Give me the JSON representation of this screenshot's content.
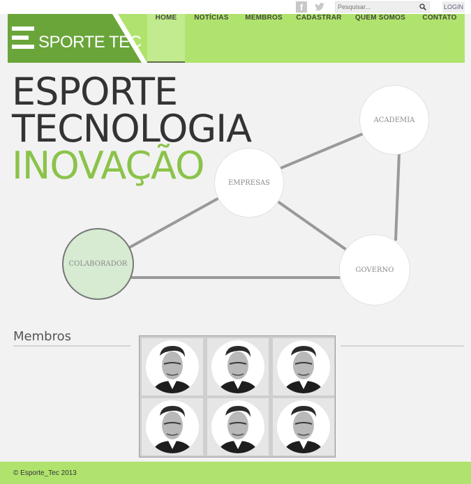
{
  "header": {
    "social": [
      {
        "icon": "facebook-icon",
        "glyph": "f"
      },
      {
        "icon": "twitter-icon"
      }
    ],
    "search": {
      "placeholder": "Pesquisar..."
    },
    "login_label": "LOGIN"
  },
  "brand": {
    "name": "SPORTE TEC",
    "accent": "#8bc34a",
    "nav_bg": "#b0e36e"
  },
  "nav": {
    "items": [
      {
        "label": "HOME",
        "active": true
      },
      {
        "label": "NOTÍCIAS"
      },
      {
        "label": "MEMBROS"
      },
      {
        "label": "CADASTRAR"
      },
      {
        "label": "QUEM SOMOS"
      },
      {
        "label": "CONTATO"
      }
    ]
  },
  "hero": {
    "line1": "ESPORTE",
    "line2": "TECNOLOGIA",
    "line3": "INOVAÇÃO"
  },
  "diagram": {
    "nodes": {
      "academia": "ACADEMIA",
      "empresas": "EMPRESAS",
      "colaborador": "COLABORADOR",
      "governo": "GOVERNO"
    }
  },
  "members": {
    "title": "Membros",
    "count": 6
  },
  "footer": {
    "copyright": "© Esporte_Tec 2013"
  }
}
